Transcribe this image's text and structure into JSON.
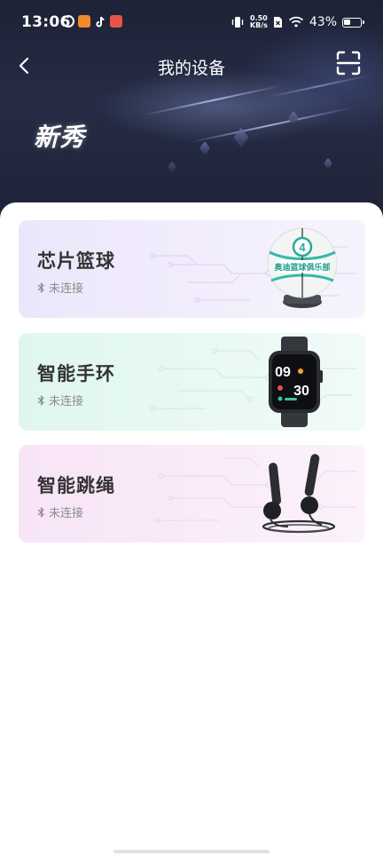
{
  "status_bar": {
    "time": "13:06",
    "net_speed_value": "0.50",
    "net_speed_unit": "KB/s",
    "battery_percent": "43%",
    "battery_level": 0.43
  },
  "nav": {
    "title": "我的设备"
  },
  "brand": {
    "text": "新秀"
  },
  "devices": [
    {
      "name": "芯片篮球",
      "status": "未连接",
      "icon": "basketball",
      "ball_number": "4",
      "ball_text": "奥迪篮球俱乐部",
      "bg_from": "#ece6fb",
      "bg_to": "#f7f3fd"
    },
    {
      "name": "智能手环",
      "status": "未连接",
      "icon": "smartwatch",
      "watch_time_hour": "09",
      "watch_time_min": "30",
      "bg_from": "#dff6ef",
      "bg_to": "#f1fbf8"
    },
    {
      "name": "智能跳绳",
      "status": "未连接",
      "icon": "jump-rope",
      "bg_from": "#f8e4f7",
      "bg_to": "#fbf2fb"
    }
  ],
  "colors": {
    "header_dark": "#1d2236",
    "title_text": "#333333",
    "status_text": "#8c8c8c"
  }
}
